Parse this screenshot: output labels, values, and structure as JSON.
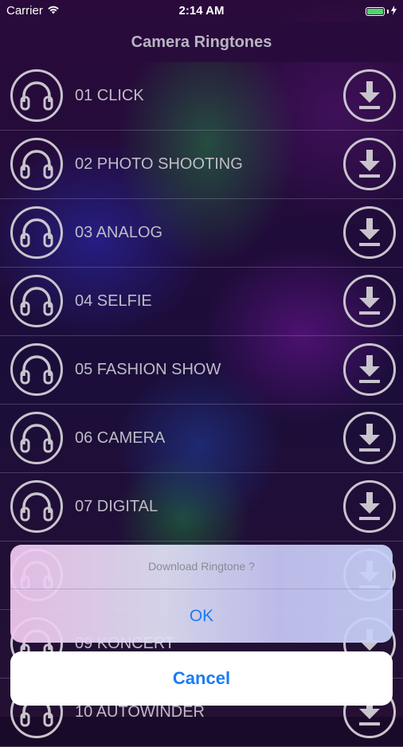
{
  "status_bar": {
    "carrier": "Carrier",
    "time": "2:14 AM",
    "battery_level": 1.0,
    "wifi_icon": "wifi-icon",
    "battery_icon": "battery-icon",
    "charging_icon": "charging-bolt-icon"
  },
  "nav": {
    "title": "Camera Ringtones"
  },
  "ringtones": [
    {
      "label": "01 CLICK"
    },
    {
      "label": "02 PHOTO SHOOTING"
    },
    {
      "label": "03 ANALOG"
    },
    {
      "label": "04 SELFIE"
    },
    {
      "label": "05 FASHION SHOW"
    },
    {
      "label": "06 CAMERA"
    },
    {
      "label": "07 DIGITAL"
    },
    {
      "label": ""
    },
    {
      "label": "09 KONCERT"
    },
    {
      "label": "10 AUTOWINDER"
    }
  ],
  "icons": {
    "row_left": "headphones-icon",
    "row_right": "download-icon"
  },
  "alert": {
    "message": "Download Ringtone ?",
    "ok_label": "OK",
    "cancel_label": "Cancel"
  },
  "colors": {
    "accent": "#1a7cf5",
    "battery": "#4cd964",
    "text_muted": "#bfbcc6"
  }
}
